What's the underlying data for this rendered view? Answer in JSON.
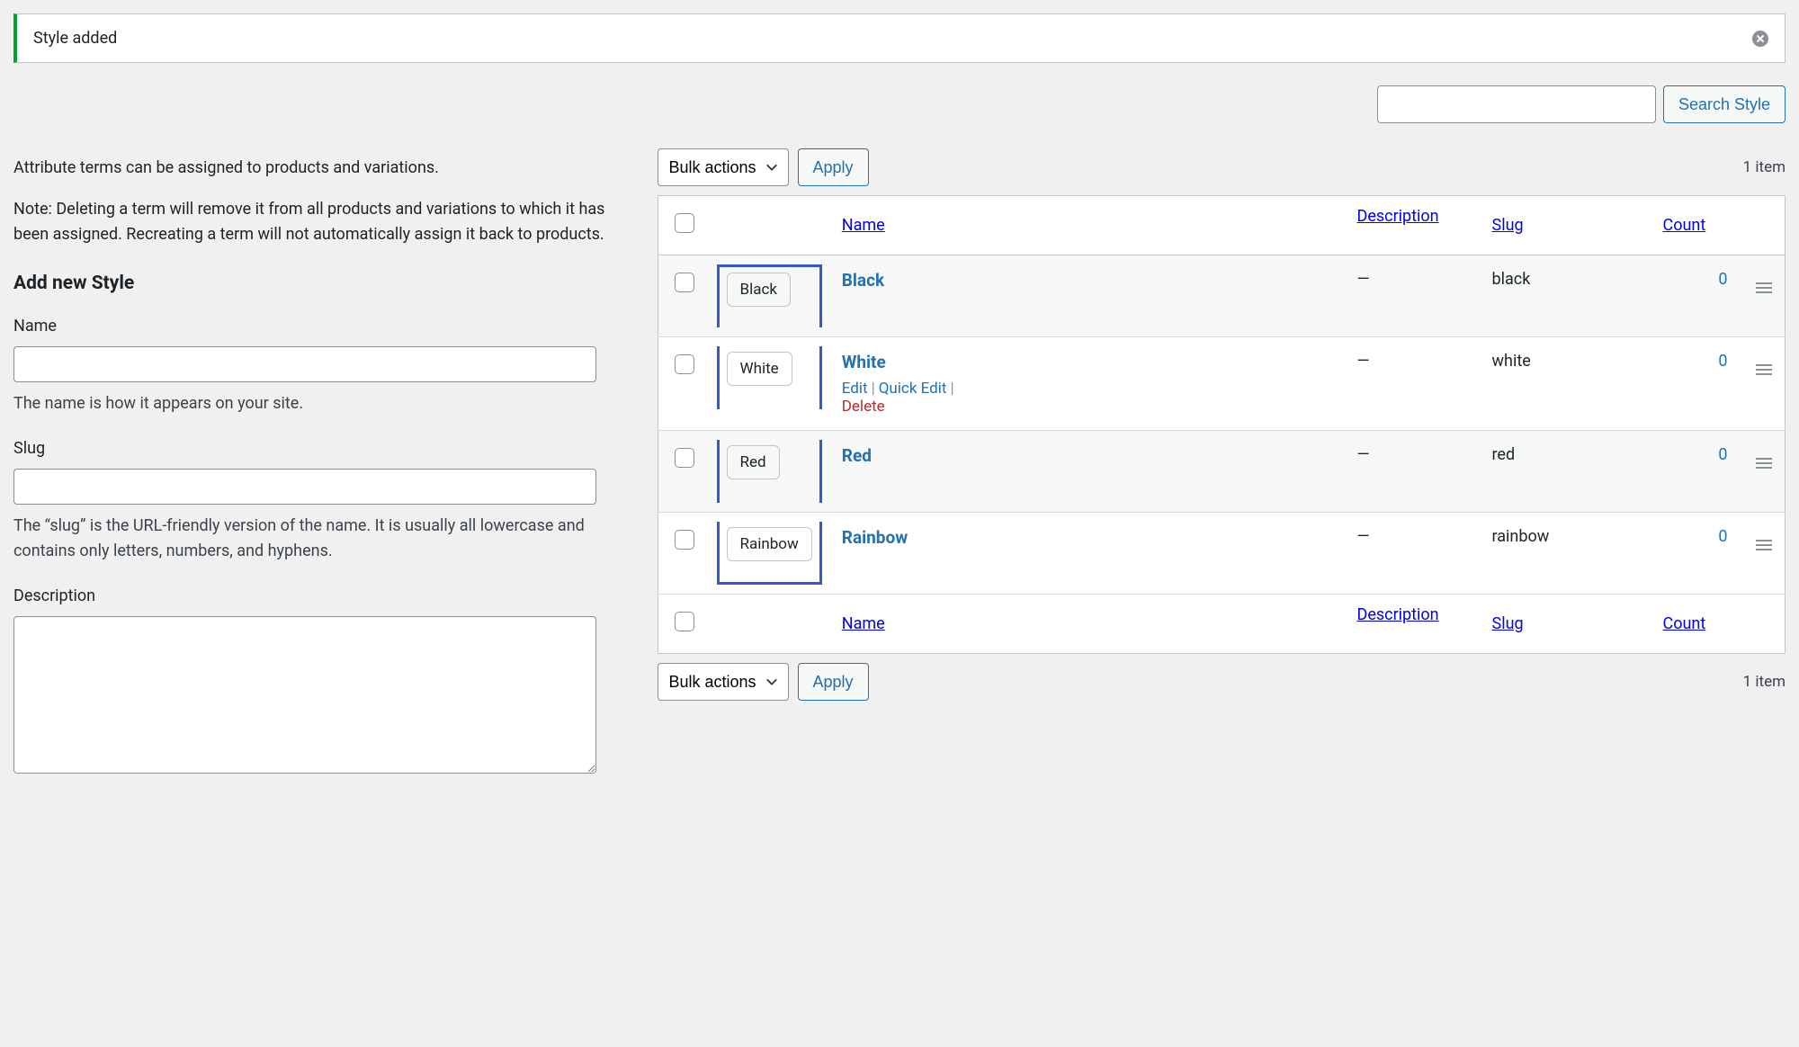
{
  "notice": {
    "message": "Style added"
  },
  "search": {
    "button": "Search Style"
  },
  "sidebar": {
    "intro1": "Attribute terms can be assigned to products and variations.",
    "intro2": "Note: Deleting a term will remove it from all products and variations to which it has been assigned. Recreating a term will not automatically assign it back to products.",
    "heading": "Add new Style",
    "name_label": "Name",
    "name_help": "The name is how it appears on your site.",
    "slug_label": "Slug",
    "slug_help": "The “slug” is the URL-friendly version of the name. It is usually all lowercase and contains only letters, numbers, and hyphens.",
    "desc_label": "Description"
  },
  "bulk": {
    "label": "Bulk actions",
    "apply": "Apply"
  },
  "pagination": {
    "count_text": "1 item"
  },
  "columns": {
    "name": "Name",
    "description": "Description",
    "slug": "Slug",
    "count": "Count"
  },
  "row_actions": {
    "edit": "Edit",
    "quick_edit": "Quick Edit",
    "delete": "Delete"
  },
  "rows": [
    {
      "chip": "Black",
      "name": "Black",
      "desc": "—",
      "slug": "black",
      "count": "0",
      "show_actions": false
    },
    {
      "chip": "White",
      "name": "White",
      "desc": "—",
      "slug": "white",
      "count": "0",
      "show_actions": true
    },
    {
      "chip": "Red",
      "name": "Red",
      "desc": "—",
      "slug": "red",
      "count": "0",
      "show_actions": false
    },
    {
      "chip": "Rainbow",
      "name": "Rainbow",
      "desc": "—",
      "slug": "rainbow",
      "count": "0",
      "show_actions": false
    }
  ]
}
